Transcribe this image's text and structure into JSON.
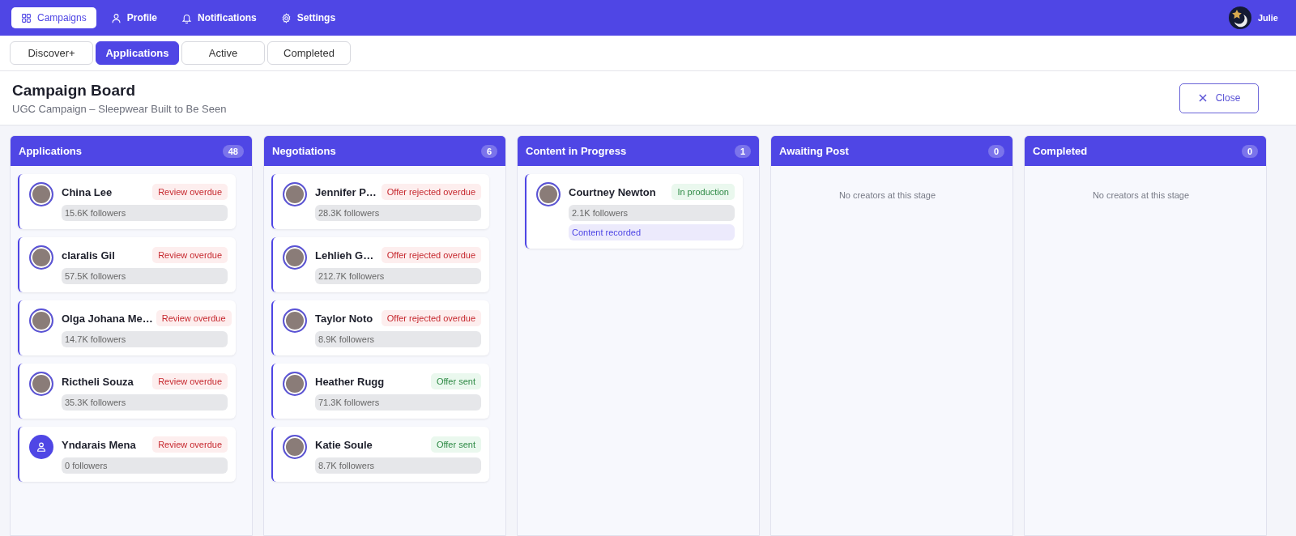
{
  "nav": {
    "items": [
      {
        "label": "Campaigns",
        "selected": true
      },
      {
        "label": "Profile",
        "selected": false
      },
      {
        "label": "Notifications",
        "selected": false
      },
      {
        "label": "Settings",
        "selected": false
      }
    ],
    "user": {
      "name": "Julie"
    }
  },
  "tabs": [
    {
      "label": "Discover+",
      "selected": false
    },
    {
      "label": "Applications",
      "selected": true
    },
    {
      "label": "Active",
      "selected": false
    },
    {
      "label": "Completed",
      "selected": false
    }
  ],
  "header": {
    "title": "Campaign Board",
    "subtitle": "UGC Campaign – Sleepwear Built to Be Seen",
    "close_button": "Close"
  },
  "columns": [
    {
      "title": "Applications",
      "count": "48",
      "cards": [
        {
          "kind": "photo",
          "name": "China Lee",
          "status": {
            "label": "Review overdue",
            "kind": "warning"
          },
          "followers": "15.6K followers"
        },
        {
          "kind": "photo",
          "name": "claralis Gil",
          "status": {
            "label": "Review overdue",
            "kind": "warning"
          },
          "followers": "57.5K followers"
        },
        {
          "kind": "photo",
          "name": "Olga Johana Me…",
          "status": {
            "label": "Review overdue",
            "kind": "warning"
          },
          "followers": "14.7K followers"
        },
        {
          "kind": "photo",
          "name": "Rictheli Souza",
          "status": {
            "label": "Review overdue",
            "kind": "warning"
          },
          "followers": "35.3K followers"
        },
        {
          "kind": "placeholder",
          "name": "Yndarais Mena",
          "status": {
            "label": "Review overdue",
            "kind": "warning"
          },
          "followers": "0 followers"
        }
      ]
    },
    {
      "title": "Negotiations",
      "count": "6",
      "cards": [
        {
          "kind": "photo",
          "name": "Jennifer P…",
          "status": {
            "label": "Offer rejected overdue",
            "kind": "warning"
          },
          "followers": "28.3K followers"
        },
        {
          "kind": "photo",
          "name": "Lehlieh G…",
          "status": {
            "label": "Offer rejected overdue",
            "kind": "warning"
          },
          "followers": "212.7K followers"
        },
        {
          "kind": "photo",
          "name": "Taylor Noto",
          "status": {
            "label": "Offer rejected overdue",
            "kind": "warning"
          },
          "followers": "8.9K followers"
        },
        {
          "kind": "photo",
          "name": "Heather Rugg",
          "status": {
            "label": "Offer sent",
            "kind": "success"
          },
          "followers": "71.3K followers"
        },
        {
          "kind": "photo",
          "name": "Katie Soule",
          "status": {
            "label": "Offer sent",
            "kind": "success"
          },
          "followers": "8.7K followers"
        }
      ]
    },
    {
      "title": "Content in Progress",
      "count": "1",
      "cards": [
        {
          "kind": "photo",
          "name": "Courtney Newton",
          "status": {
            "label": "In production",
            "kind": "success"
          },
          "followers": "2.1K followers",
          "note": "Content recorded"
        }
      ]
    },
    {
      "title": "Awaiting Post",
      "count": "0",
      "empty_text": "No creators at this stage"
    },
    {
      "title": "Completed",
      "count": "0",
      "empty_text": "No creators at this stage"
    }
  ]
}
